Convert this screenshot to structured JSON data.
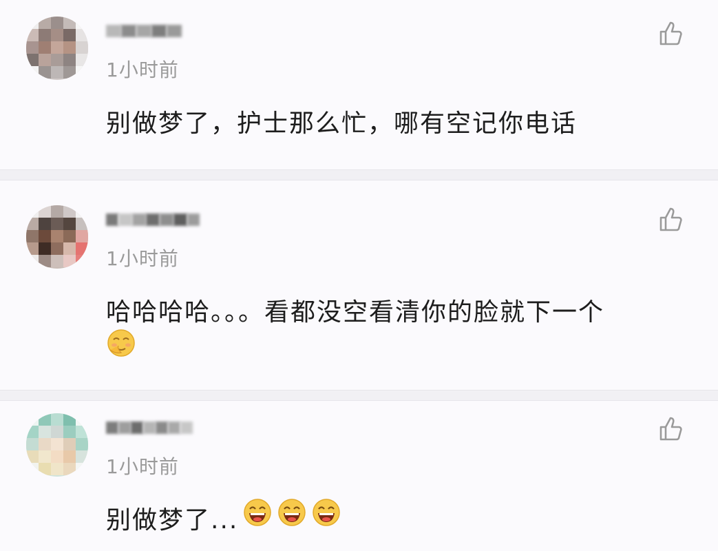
{
  "comments": [
    {
      "time": "1小时前",
      "text": "别做梦了，护士那么忙，哪有空记你电话"
    },
    {
      "time": "1小时前",
      "text": "哈哈哈哈。。。看都没空看清你的脸就下一个"
    },
    {
      "time": "1小时前",
      "text": "别做梦了..."
    }
  ],
  "icons": {
    "like": "thumbs-up-icon",
    "emoji_shy": "shy-face-emoji",
    "emoji_laugh": "laughing-face-emoji"
  }
}
